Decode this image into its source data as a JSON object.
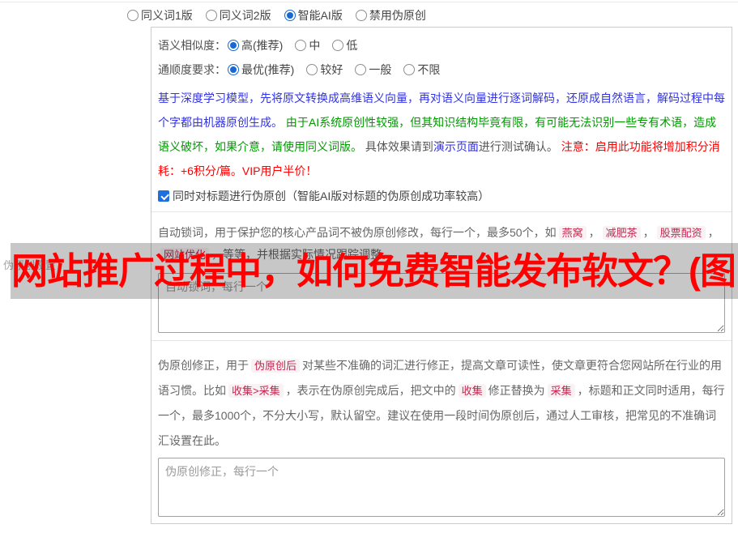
{
  "overlay": {
    "watermark_title": "网站推广过程中，如何免费智能发布软文？(图"
  },
  "form": {
    "row_label": "伪原创设置",
    "version_group": {
      "options": [
        {
          "label": "同义词1版",
          "selected": false
        },
        {
          "label": "同义词2版",
          "selected": false
        },
        {
          "label": "智能AI版",
          "selected": true
        },
        {
          "label": "禁用伪原创",
          "selected": false
        }
      ]
    },
    "similarity": {
      "label": "语义相似度：",
      "options": [
        {
          "label": "高(推荐)",
          "selected": true
        },
        {
          "label": "中",
          "selected": false
        },
        {
          "label": "低",
          "selected": false
        }
      ]
    },
    "fluency": {
      "label": "通顺度要求：",
      "options": [
        {
          "label": "最优(推荐)",
          "selected": true
        },
        {
          "label": "较好",
          "selected": false
        },
        {
          "label": "一般",
          "selected": false
        },
        {
          "label": "不限",
          "selected": false
        }
      ]
    },
    "ai_note_segments": [
      {
        "text": "基于深度学习模型，先将原文转换成高维语义向量，再对语义向量进行逐词解码，还原成自然语言，解码过程中每个字都由机器原创生成。",
        "cls": "t-blue"
      },
      {
        "text": " 由于AI系统原创性较强，但其知识结构毕竟有限，有可能无法识别一些专有术语，造成语义破坏，如果介意，请使用同义词版。",
        "cls": "t-green"
      },
      {
        "text": " 具体效果请到",
        "cls": "t-dark"
      },
      {
        "text": "演示页面",
        "cls": "t-link"
      },
      {
        "text": "进行测试确认。",
        "cls": "t-dark"
      },
      {
        "text": " 注意：启用此功能将增加积分消耗：+6积分/篇。VIP用户半价！",
        "cls": "t-red"
      }
    ],
    "title_rewrite": {
      "label": "同时对标题进行伪原创（智能AI版对标题的伪原创成功率较高）",
      "checked": true
    },
    "lock_words": {
      "segments": [
        {
          "text": "自动锁词，用于保护您的核心产品词不被伪原创修改，每行一个，最多50个，如",
          "cls": "t-gray"
        },
        {
          "text": "燕窝",
          "cls": "kw"
        },
        {
          "text": "，",
          "cls": "t-gray"
        },
        {
          "text": "减肥茶",
          "cls": "kw"
        },
        {
          "text": "，",
          "cls": "t-gray"
        },
        {
          "text": "股票配资",
          "cls": "kw"
        },
        {
          "text": "，",
          "cls": "t-gray"
        },
        {
          "text": "网站优化",
          "cls": "kw"
        },
        {
          "text": "，等等，并根据实际情况跟踪调整。",
          "cls": "t-gray"
        }
      ],
      "textarea_placeholder": "自动锁词，每行一个",
      "textarea_value": ""
    },
    "correction": {
      "segments": [
        {
          "text": "伪原创修正，用于",
          "cls": "t-gray"
        },
        {
          "text": "伪原创后",
          "cls": "kw"
        },
        {
          "text": "对某些不准确的词汇进行修正，提高文章可读性，使文章更符合您网站所在行业的用语习惯。比如",
          "cls": "t-gray"
        },
        {
          "text": "收集>采集",
          "cls": "kw"
        },
        {
          "text": "，表示在伪原创完成后，把文中的",
          "cls": "t-gray"
        },
        {
          "text": "收集",
          "cls": "kw"
        },
        {
          "text": "修正替换为",
          "cls": "t-gray"
        },
        {
          "text": "采集",
          "cls": "kw"
        },
        {
          "text": "，标题和正文同时适用，每行一个，最多1000个，不分大小写，默认留空。建议在使用一段时间伪原创后，通过人工审核，把常见的不准确词汇设置在此。",
          "cls": "t-gray"
        }
      ],
      "textarea_placeholder": "伪原创修正，每行一个",
      "textarea_value": ""
    }
  },
  "colors": {
    "accent_blue": "#1668d5",
    "note_blue": "#3032e8",
    "note_green": "#009a00",
    "note_red": "#fe0000",
    "link_blue": "#2a2af0",
    "keyword_text": "#c7254e",
    "keyword_bg": "#f9f2f4",
    "watermark_red": "#ff0000",
    "panel_border": "#cccccc"
  }
}
